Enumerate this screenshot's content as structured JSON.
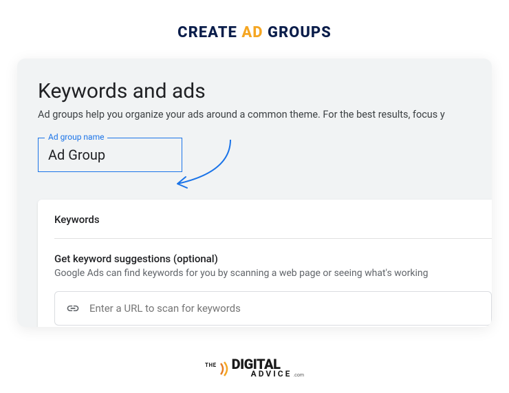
{
  "page_title": {
    "part1": "CREATE ",
    "accent": "AD",
    "part2": " GROUPS"
  },
  "screenshot": {
    "heading": "Keywords and ads",
    "subtext": "Ad groups help you organize your ads around a common theme. For the best results, focus y",
    "input": {
      "label": "Ad group name",
      "value": "Ad Group"
    },
    "card": {
      "title": "Keywords",
      "suggest_title": "Get keyword suggestions (optional)",
      "suggest_desc": "Google Ads can find keywords for you by scanning a web page or seeing what's working",
      "url_placeholder": "Enter a URL to scan for keywords"
    }
  },
  "footer": {
    "the": "THE",
    "main": "DIGITAL",
    "advice": "ADVICE",
    "com": ".com"
  }
}
